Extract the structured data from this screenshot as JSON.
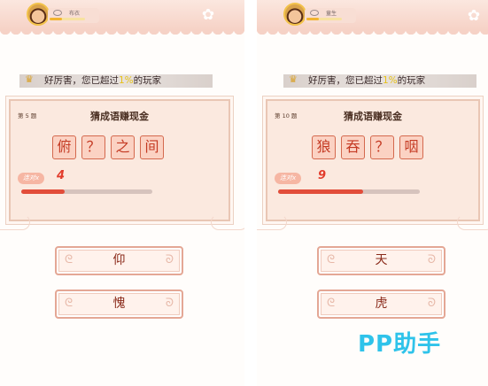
{
  "left": {
    "username": "布衣",
    "banner": {
      "pre": "好厉害，您已超过",
      "pct": "1%",
      "post": "的玩家"
    },
    "level": "第 5 题",
    "title": "猜成语赚现金",
    "chars": [
      "俯",
      "？",
      "之",
      "间"
    ],
    "combo_label": "连对x",
    "combo_count": "4",
    "progress": 0.33,
    "answers": [
      "仰",
      "愧"
    ]
  },
  "right": {
    "username": "童生",
    "banner": {
      "pre": "好厉害，您已超过",
      "pct": "1%",
      "post": "的玩家"
    },
    "level": "第 10 题",
    "title": "猜成语赚现金",
    "chars": [
      "狼",
      "吞",
      "？",
      "咽"
    ],
    "combo_label": "连对x",
    "combo_count": "9",
    "progress": 0.6,
    "answers": [
      "天",
      "虎"
    ]
  },
  "watermark": "PP助手",
  "icons": {
    "settings": "gear-icon",
    "trophy": "trophy-icon",
    "eye": "eye-icon"
  },
  "colors": {
    "accent": "#e24d3a",
    "topbar": "#f6d2c6",
    "watermark": "#2fc3ea"
  }
}
